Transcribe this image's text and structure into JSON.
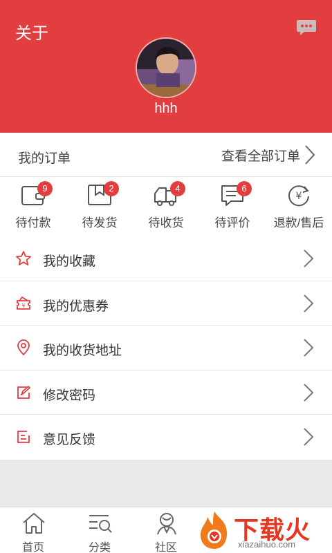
{
  "header": {
    "title": "关于",
    "username": "hhh",
    "colors": {
      "background": "#e23d3f",
      "text": "#ffffff"
    }
  },
  "orders": {
    "title": "我的订单",
    "view_all": "查看全部订单",
    "items": [
      {
        "label": "待付款",
        "badge": "9",
        "icon": "wallet-icon"
      },
      {
        "label": "待发货",
        "badge": "2",
        "icon": "package-icon"
      },
      {
        "label": "待收货",
        "badge": "4",
        "icon": "truck-icon"
      },
      {
        "label": "待评价",
        "badge": "6",
        "icon": "comment-icon"
      },
      {
        "label": "退款/售后",
        "badge": "",
        "icon": "refund-icon"
      }
    ]
  },
  "menu": {
    "items": [
      {
        "label": "我的收藏",
        "icon": "star-icon"
      },
      {
        "label": "我的优惠券",
        "icon": "coupon-icon"
      },
      {
        "label": "我的收货地址",
        "icon": "location-icon"
      },
      {
        "label": "修改密码",
        "icon": "edit-password-icon"
      },
      {
        "label": "意见反馈",
        "icon": "feedback-icon"
      }
    ]
  },
  "bottom_nav": {
    "items": [
      {
        "label": "首页",
        "icon": "home-icon"
      },
      {
        "label": "分类",
        "icon": "category-search-icon"
      },
      {
        "label": "社区",
        "icon": "community-icon"
      }
    ]
  },
  "watermark": {
    "text": "下载火",
    "sub": "xiazaihuo.com"
  },
  "accent_color": "#e23d3f"
}
